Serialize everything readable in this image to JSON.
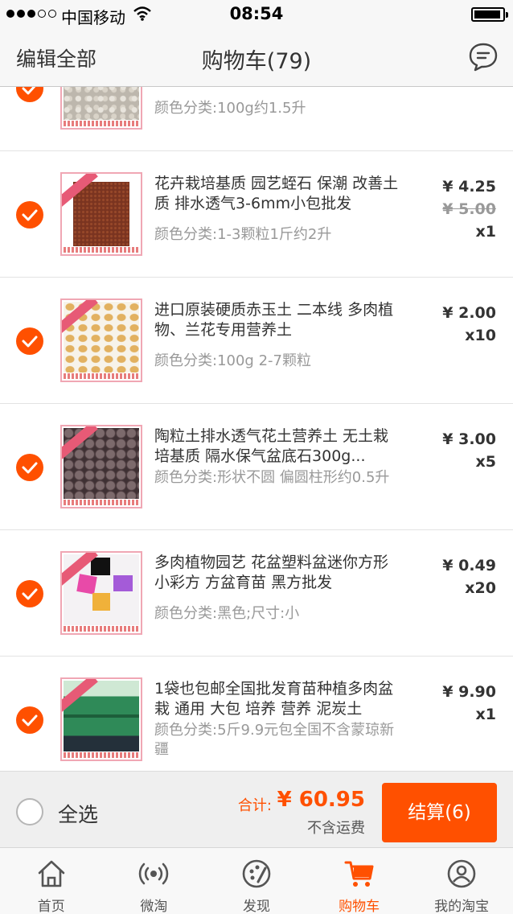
{
  "status_bar": {
    "carrier": "中国移动",
    "time": "08:54"
  },
  "header": {
    "edit_label": "编辑全部",
    "title": "购物车(79)",
    "message_icon": "chat-bubble-icon"
  },
  "items": [
    {
      "title": "",
      "spec": "颜色分类:100g约1.5升",
      "price": "",
      "original_price": "",
      "quantity": "",
      "checked": true
    },
    {
      "title": "花卉栽培基质 园艺蛭石 保潮 改善土质 排水透气3-6mm小包批发",
      "spec": "颜色分类:1-3颗粒1斤约2升",
      "price": "¥ 4.25",
      "original_price": "¥ 5.00",
      "quantity": "x1",
      "checked": true
    },
    {
      "title": "进口原装硬质赤玉土 二本线 多肉植物、兰花专用营养土",
      "spec": "颜色分类:100g 2-7颗粒",
      "price": "¥ 2.00",
      "original_price": "",
      "quantity": "x10",
      "checked": true
    },
    {
      "title": "陶粒土排水透气花土营养土 无土栽培基质 隔水保气盆底石300g...",
      "spec": "颜色分类:形状不圆  偏圆柱形约0.5升",
      "price": "¥ 3.00",
      "original_price": "",
      "quantity": "x5",
      "checked": true
    },
    {
      "title": "多肉植物园艺 花盆塑料盆迷你方形 小彩方 方盆育苗 黑方批发",
      "spec": "颜色分类:黑色;尺寸:小",
      "price": "¥ 0.49",
      "original_price": "",
      "quantity": "x20",
      "checked": true
    },
    {
      "title": "1袋也包邮全国批发育苗种植多肉盆栽 通用 大包 培养 营养 泥炭土",
      "spec": "颜色分类:5斤9.9元包全国不含蒙琼新疆",
      "price": "¥ 9.90",
      "original_price": "",
      "quantity": "x1",
      "checked": true
    }
  ],
  "summary": {
    "select_all_label": "全选",
    "total_label": "合计:",
    "total_value": "¥ 60.95",
    "freight_note": "不含运费",
    "checkout_label": "结算(6)"
  },
  "tabs": [
    {
      "label": "首页",
      "icon": "home-icon",
      "active": false
    },
    {
      "label": "微淘",
      "icon": "broadcast-icon",
      "active": false
    },
    {
      "label": "发现",
      "icon": "discover-icon",
      "active": false
    },
    {
      "label": "购物车",
      "icon": "cart-icon",
      "active": true
    },
    {
      "label": "我的淘宝",
      "icon": "profile-icon",
      "active": false
    }
  ],
  "colors": {
    "accent": "#ff5000",
    "muted_text": "#999999",
    "background": "#ffffff",
    "bar_background": "#f7f7f7"
  }
}
